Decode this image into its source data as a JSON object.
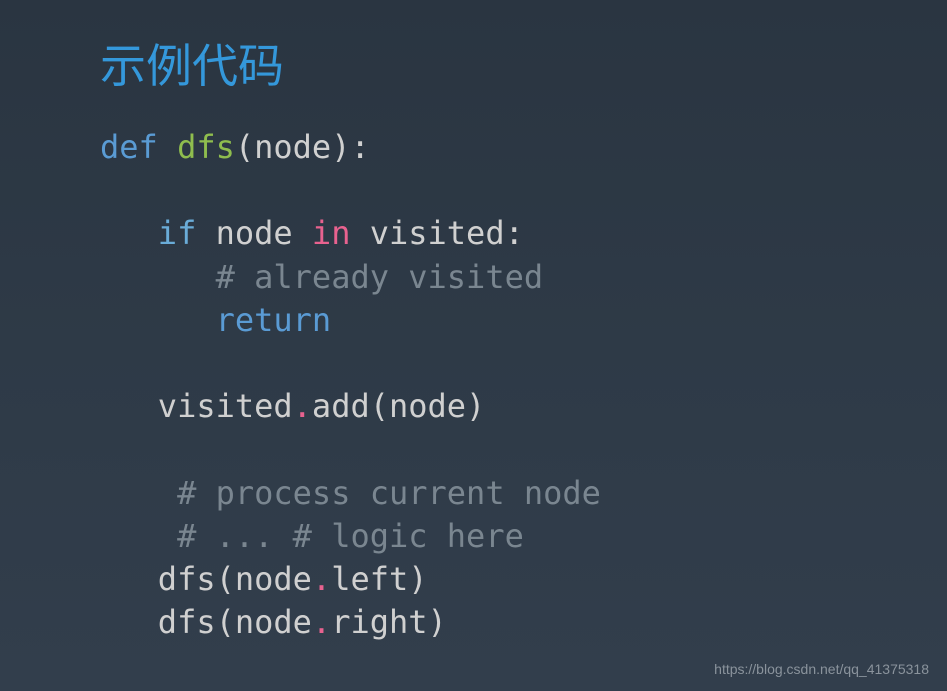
{
  "title": "示例代码",
  "code": {
    "line1": {
      "def": "def",
      "space1": " ",
      "fn": "dfs",
      "lparen": "(",
      "param": "node",
      "rparen": ")",
      "colon": ":"
    },
    "line3": {
      "indent": "   ",
      "if": "if",
      "space1": " ",
      "node": "node",
      "space2": " ",
      "in": "in",
      "space3": " ",
      "visited": "visited",
      "colon": ":"
    },
    "line4": {
      "indent": "      ",
      "comment": "# already visited"
    },
    "line5": {
      "indent": "      ",
      "return": "return"
    },
    "line7": {
      "indent": "   ",
      "visited": "visited",
      "dot": ".",
      "add": "add",
      "lparen": "(",
      "node": "node",
      "rparen": ")"
    },
    "line9": {
      "indent": "    ",
      "comment": "# process current node"
    },
    "line10": {
      "indent": "    ",
      "comment": "# ... # logic here"
    },
    "line11": {
      "indent": "   ",
      "dfs": "dfs",
      "lparen": "(",
      "node": "node",
      "dot": ".",
      "left": "left",
      "rparen": ")"
    },
    "line12": {
      "indent": "   ",
      "dfs": "dfs",
      "lparen": "(",
      "node": "node",
      "dot": ".",
      "right": "right",
      "rparen": ")"
    }
  },
  "watermark": "https://blog.csdn.net/qq_41375318"
}
